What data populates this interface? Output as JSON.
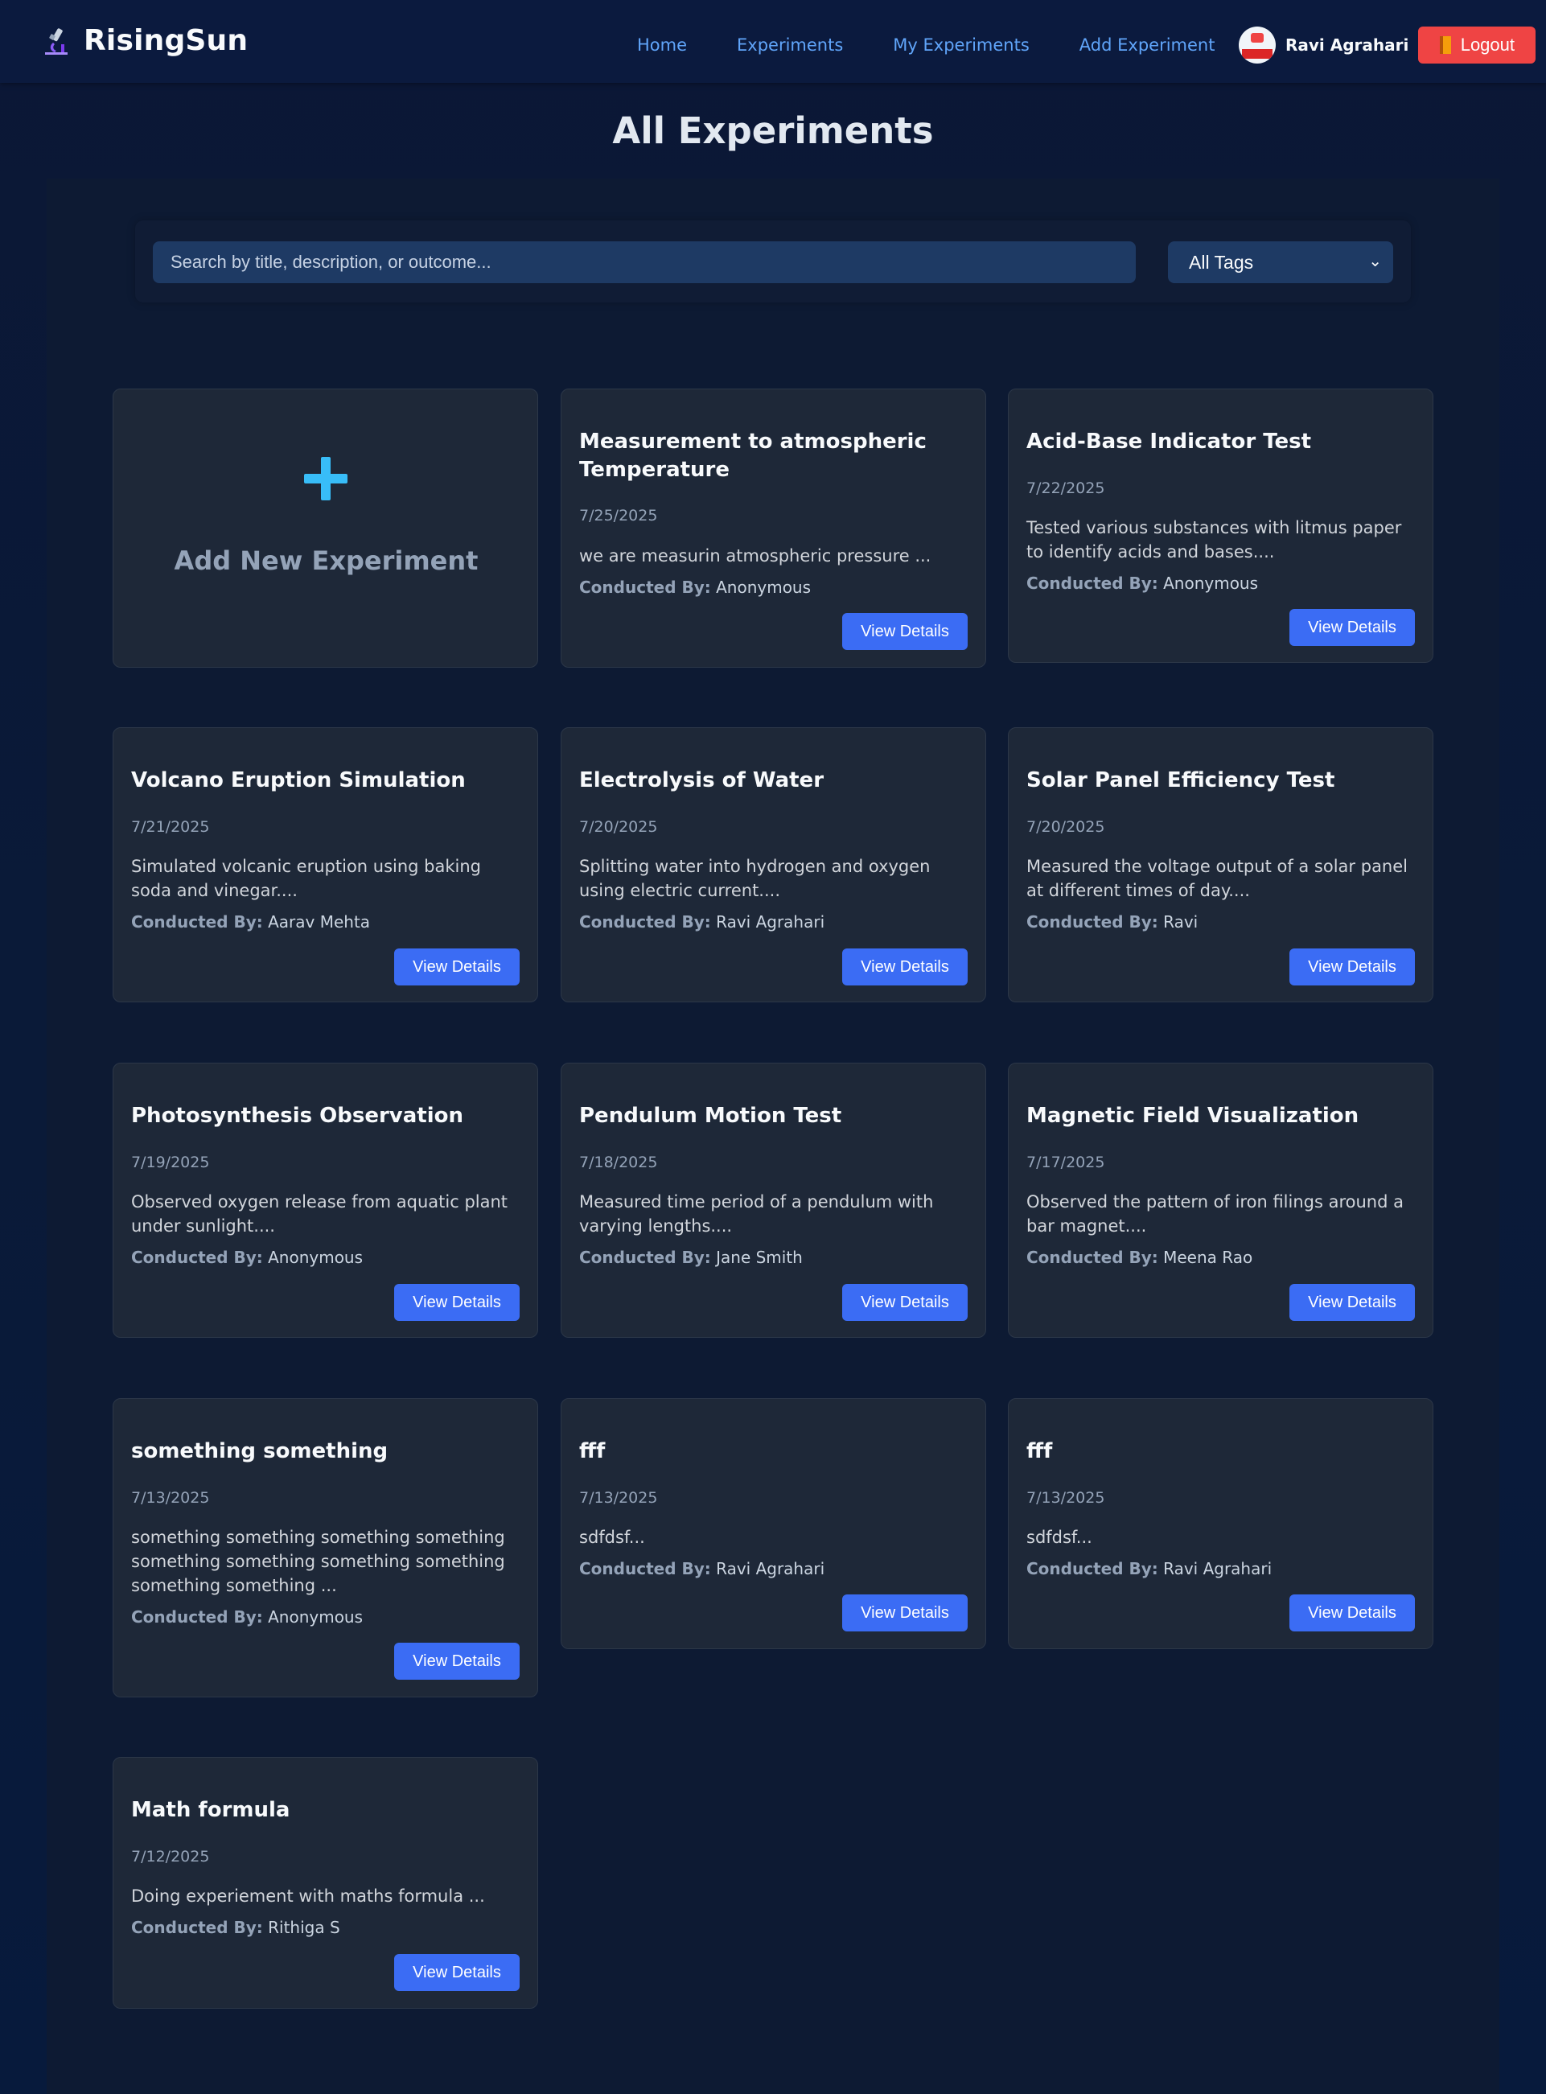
{
  "nav": {
    "brand": "RisingSun",
    "links": [
      "Home",
      "Experiments",
      "My Experiments",
      "Add Experiment"
    ],
    "user_name": "Ravi Agrahari",
    "logout_label": "Logout"
  },
  "page": {
    "title": "All Experiments"
  },
  "filters": {
    "search_placeholder": "Search by title, description, or outcome...",
    "search_value": "",
    "tag_selected": "All Tags"
  },
  "add_card": {
    "label": "Add New Experiment"
  },
  "view_details_label": "View Details",
  "conducted_by_label": "Conducted By:",
  "experiments": [
    {
      "title": "Measurement to atmospheric Temperature",
      "date": "7/25/2025",
      "desc": "we are measurin atmospheric pressure ...",
      "by": "Anonymous"
    },
    {
      "title": "Acid-Base Indicator Test",
      "date": "7/22/2025",
      "desc": "Tested various substances with litmus paper to identify acids and bases....",
      "by": "Anonymous"
    },
    {
      "title": "Volcano Eruption Simulation",
      "date": "7/21/2025",
      "desc": "Simulated volcanic eruption using baking soda and vinegar....",
      "by": "Aarav Mehta"
    },
    {
      "title": "Electrolysis of Water",
      "date": "7/20/2025",
      "desc": "Splitting water into hydrogen and oxygen using electric current....",
      "by": "Ravi Agrahari"
    },
    {
      "title": "Solar Panel Efficiency Test",
      "date": "7/20/2025",
      "desc": "Measured the voltage output of a solar panel at different times of day....",
      "by": "Ravi"
    },
    {
      "title": "Photosynthesis Observation",
      "date": "7/19/2025",
      "desc": "Observed oxygen release from aquatic plant under sunlight....",
      "by": "Anonymous"
    },
    {
      "title": "Pendulum Motion Test",
      "date": "7/18/2025",
      "desc": "Measured time period of a pendulum with varying lengths....",
      "by": "Jane Smith"
    },
    {
      "title": "Magnetic Field Visualization",
      "date": "7/17/2025",
      "desc": "Observed the pattern of iron filings around a bar magnet....",
      "by": "Meena Rao"
    },
    {
      "title": "something something",
      "date": "7/13/2025",
      "desc": "something something something something something something something something something something ...",
      "by": "Anonymous"
    },
    {
      "title": "fff",
      "date": "7/13/2025",
      "desc": "sdfdsf...",
      "by": "Ravi Agrahari"
    },
    {
      "title": "fff",
      "date": "7/13/2025",
      "desc": "sdfdsf...",
      "by": "Ravi Agrahari"
    },
    {
      "title": "Math formula",
      "date": "7/12/2025",
      "desc": "Doing experiement with maths formula ...",
      "by": "Rithiga S"
    }
  ]
}
